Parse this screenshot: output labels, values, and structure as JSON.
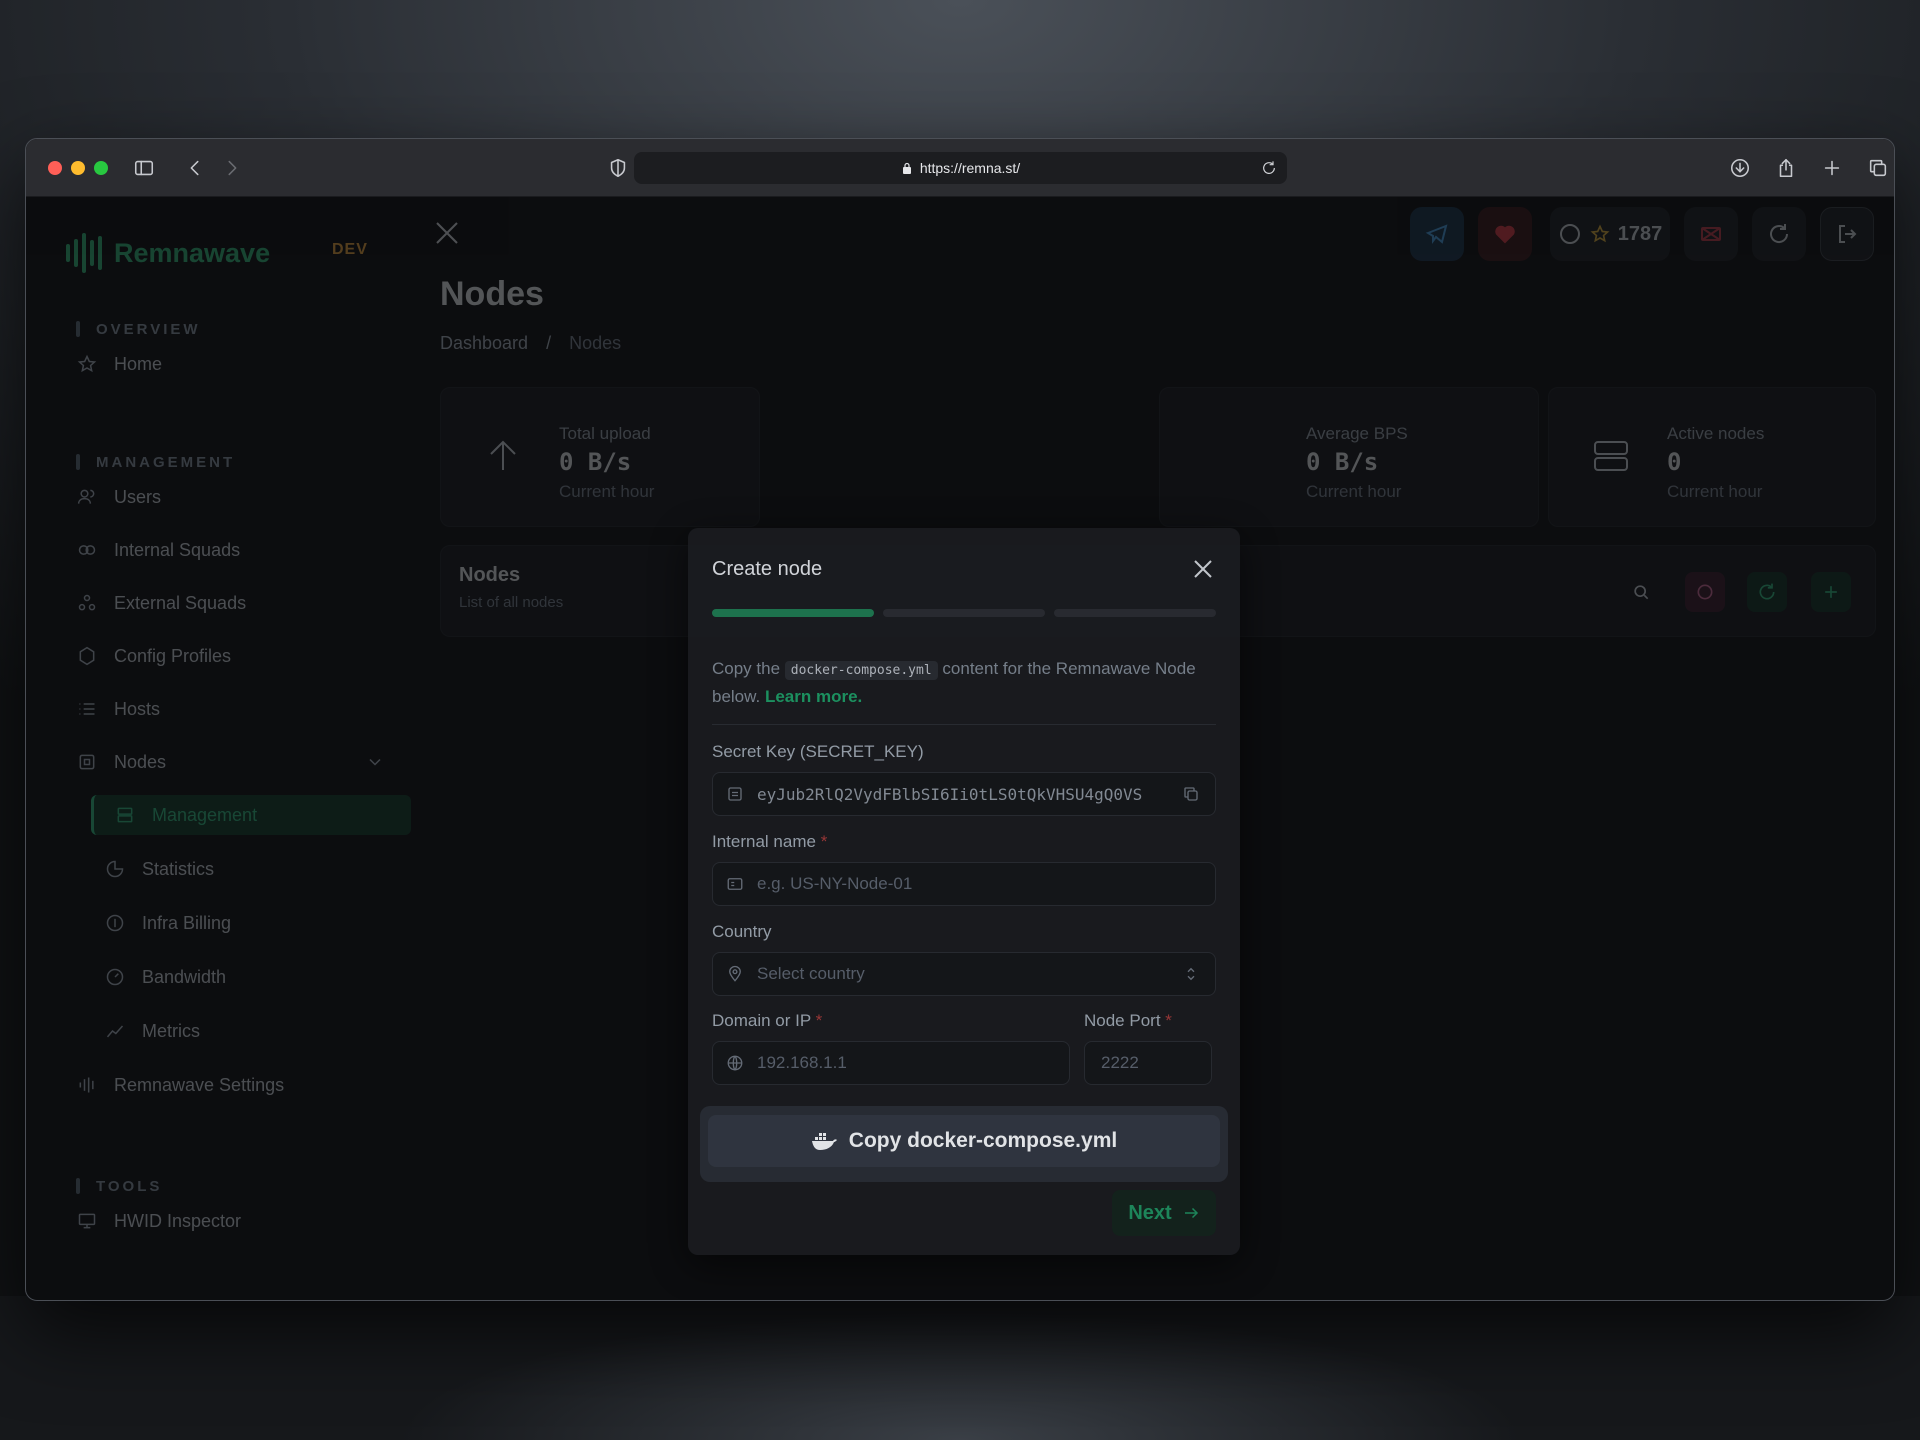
{
  "browser": {
    "url": "https://remna.st/"
  },
  "app": {
    "brand": "Remnawave",
    "env_badge": "DEV",
    "github_stars": "1787",
    "sidebar": {
      "sections": [
        {
          "label": "OVERVIEW",
          "items": [
            {
              "label": "Home",
              "icon": "star-icon"
            }
          ]
        },
        {
          "label": "MANAGEMENT",
          "items": [
            {
              "label": "Users",
              "icon": "users-icon"
            },
            {
              "label": "Internal Squads",
              "icon": "squads-icon"
            },
            {
              "label": "External Squads",
              "icon": "external-squads-icon"
            },
            {
              "label": "Config Profiles",
              "icon": "config-icon"
            },
            {
              "label": "Hosts",
              "icon": "list-icon"
            },
            {
              "label": "Nodes",
              "icon": "server-icon",
              "expanded": true
            }
          ]
        },
        {
          "label": "TOOLS",
          "items": [
            {
              "label": "HWID Inspector",
              "icon": "monitor-icon"
            }
          ]
        }
      ],
      "nodes_submenu": [
        {
          "label": "Management",
          "active": true
        },
        {
          "label": "Statistics"
        },
        {
          "label": "Infra Billing"
        },
        {
          "label": "Bandwidth"
        },
        {
          "label": "Metrics"
        }
      ],
      "settings_label": "Remnawave Settings"
    },
    "page": {
      "title": "Nodes",
      "breadcrumb": [
        "Dashboard",
        "Nodes"
      ]
    },
    "stats": [
      {
        "label": "Total upload",
        "value": "0 B/s",
        "sub": "Current hour"
      },
      {
        "label": "Average BPS",
        "value": "0 B/s",
        "sub": "Current hour"
      },
      {
        "label": "Active nodes",
        "value": "0",
        "sub": "Current hour"
      }
    ],
    "nodes_card": {
      "title": "Nodes",
      "subtitle": "List of all nodes"
    }
  },
  "modal": {
    "title": "Create node",
    "steps_total": 3,
    "steps_done": 1,
    "description_prefix": "Copy the",
    "description_code": "docker-compose.yml",
    "description_suffix": "content for the Remnawave Node below.",
    "learn_more": "Learn more.",
    "secret_key": {
      "label": "Secret Key (SECRET_KEY)",
      "value": "eyJub2RlQ2VydFBlbSI6Ii0tLS0tQkVHSU4gQ0VS"
    },
    "internal_name": {
      "label": "Internal name",
      "required_mark": "*",
      "placeholder": "e.g. US-NY-Node-01"
    },
    "country": {
      "label": "Country",
      "placeholder": "Select country"
    },
    "domain": {
      "label": "Domain or IP",
      "required_mark": "*",
      "placeholder": "192.168.1.1"
    },
    "port": {
      "label": "Node Port",
      "required_mark": "*",
      "placeholder": "2222"
    },
    "copy_button": "Copy docker-compose.yml",
    "next_button": "Next"
  }
}
